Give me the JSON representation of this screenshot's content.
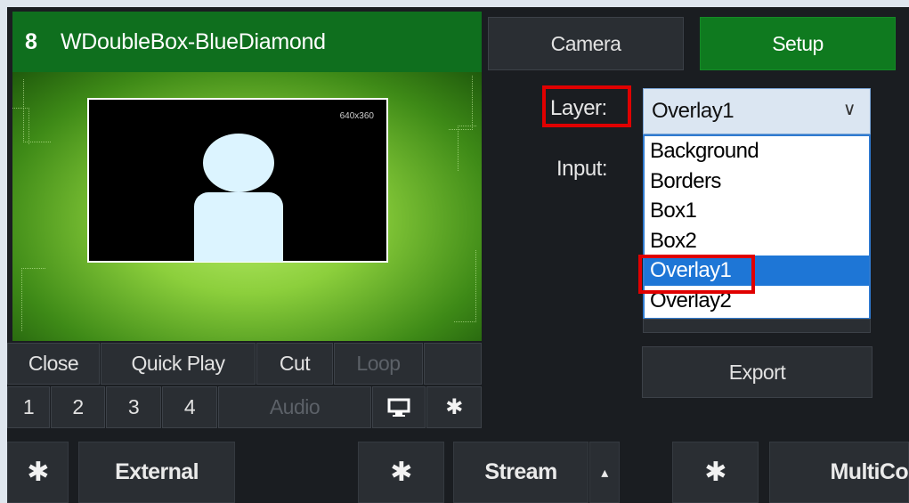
{
  "input": {
    "number": "8",
    "name": "WDoubleBox-BlueDiamond",
    "preview_resolution": "640x360",
    "controls_row1": [
      "Close",
      "Quick Play",
      "Cut",
      "Loop"
    ],
    "controls_row2": [
      "1",
      "2",
      "3",
      "4",
      "Audio"
    ],
    "monitor_icon": "monitor-icon",
    "settings_icon": "gear-icon"
  },
  "setup_panel": {
    "tabs": {
      "camera": "Camera",
      "setup": "Setup"
    },
    "layer_label": "Layer:",
    "input_label": "Input:",
    "layer_selected": "Overlay1",
    "layer_options": [
      "Background",
      "Borders",
      "Box1",
      "Box2",
      "Overlay1",
      "Overlay2"
    ],
    "highlighted_option": "Overlay1",
    "export_label": "Export"
  },
  "bottom_bar": {
    "external_label": "External",
    "stream_label": "Stream",
    "stream_arrow": "▴",
    "multicorder_label": "MultiCo"
  },
  "colors": {
    "setup_tab": "#0f7a1f",
    "title_bar": "#0f6f1e",
    "selection": "#1e76d6",
    "highlight_outline": "#e00000"
  }
}
